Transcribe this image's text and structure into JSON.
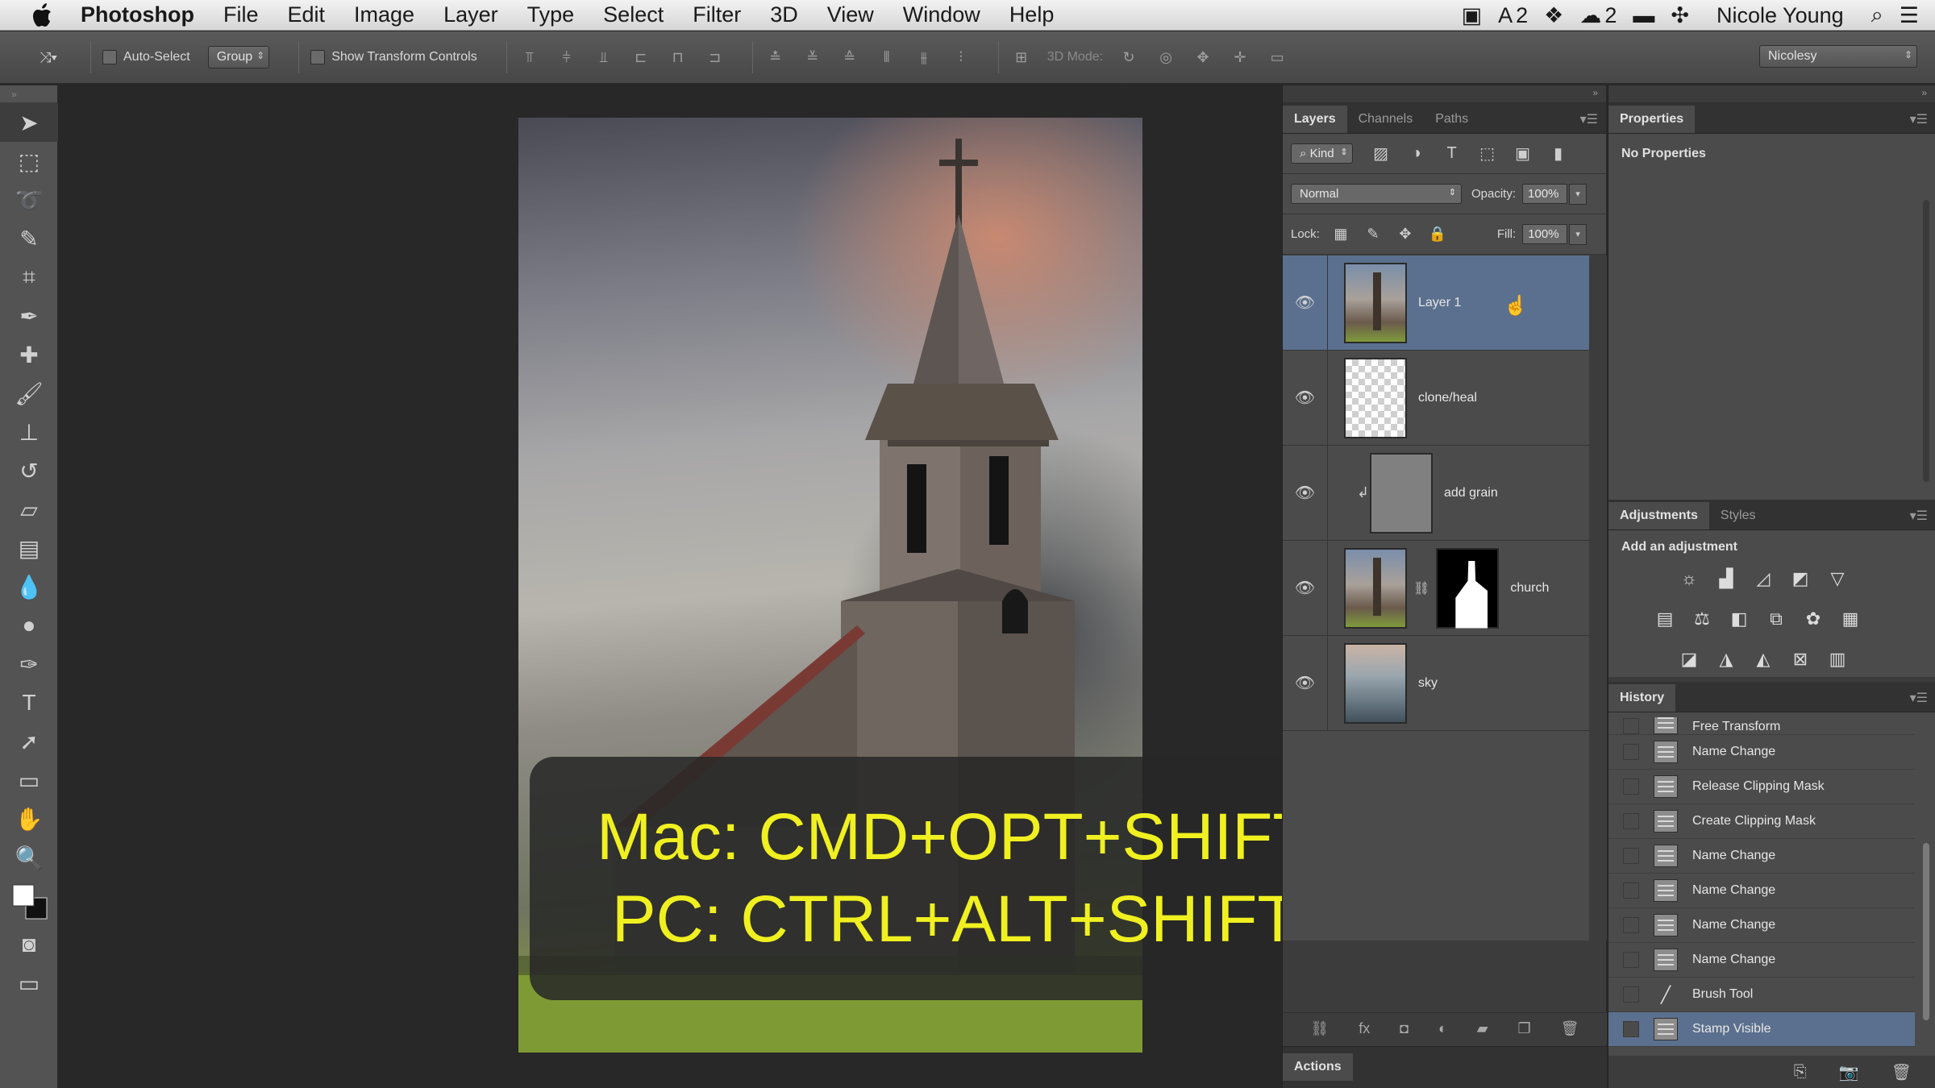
{
  "menubar": {
    "app_name": "Photoshop",
    "menus": [
      "File",
      "Edit",
      "Image",
      "Layer",
      "Type",
      "Select",
      "Filter",
      "3D",
      "View",
      "Window",
      "Help"
    ],
    "status": {
      "adobe_count": "2",
      "cc_count": "2"
    },
    "user": "Nicole Young"
  },
  "options": {
    "auto_select": "Auto-Select",
    "group": "Group",
    "show_transform": "Show Transform Controls",
    "mode_3d": "3D Mode:",
    "workspace": "Nicolesy"
  },
  "canvas": {
    "shortcut_mac": "Mac: CMD+OPT+SHIFT+E",
    "shortcut_pc": "PC: CTRL+ALT+SHIFT+E"
  },
  "layers_panel": {
    "tabs": [
      "Layers",
      "Channels",
      "Paths"
    ],
    "kind": "Kind",
    "blend_mode": "Normal",
    "opacity_label": "Opacity:",
    "opacity": "100%",
    "lock_label": "Lock:",
    "fill_label": "Fill:",
    "fill": "100%",
    "layers": [
      {
        "name": "Layer 1",
        "selected": true
      },
      {
        "name": "clone/heal"
      },
      {
        "name": "add grain"
      },
      {
        "name": "church"
      },
      {
        "name": "sky"
      }
    ],
    "actions_tab": "Actions"
  },
  "properties": {
    "tab": "Properties",
    "empty_text": "No Properties"
  },
  "adjustments": {
    "tabs": [
      "Adjustments",
      "Styles"
    ],
    "label": "Add an adjustment"
  },
  "history": {
    "tab": "History",
    "items": [
      "Free Transform",
      "Name Change",
      "Release Clipping Mask",
      "Create Clipping Mask",
      "Name Change",
      "Name Change",
      "Name Change",
      "Name Change",
      "Brush Tool",
      "Stamp Visible"
    ],
    "selected": "Stamp Visible"
  },
  "colors": {
    "accent_selection": "#5b708e",
    "shortcut_text": "#f0f020"
  }
}
